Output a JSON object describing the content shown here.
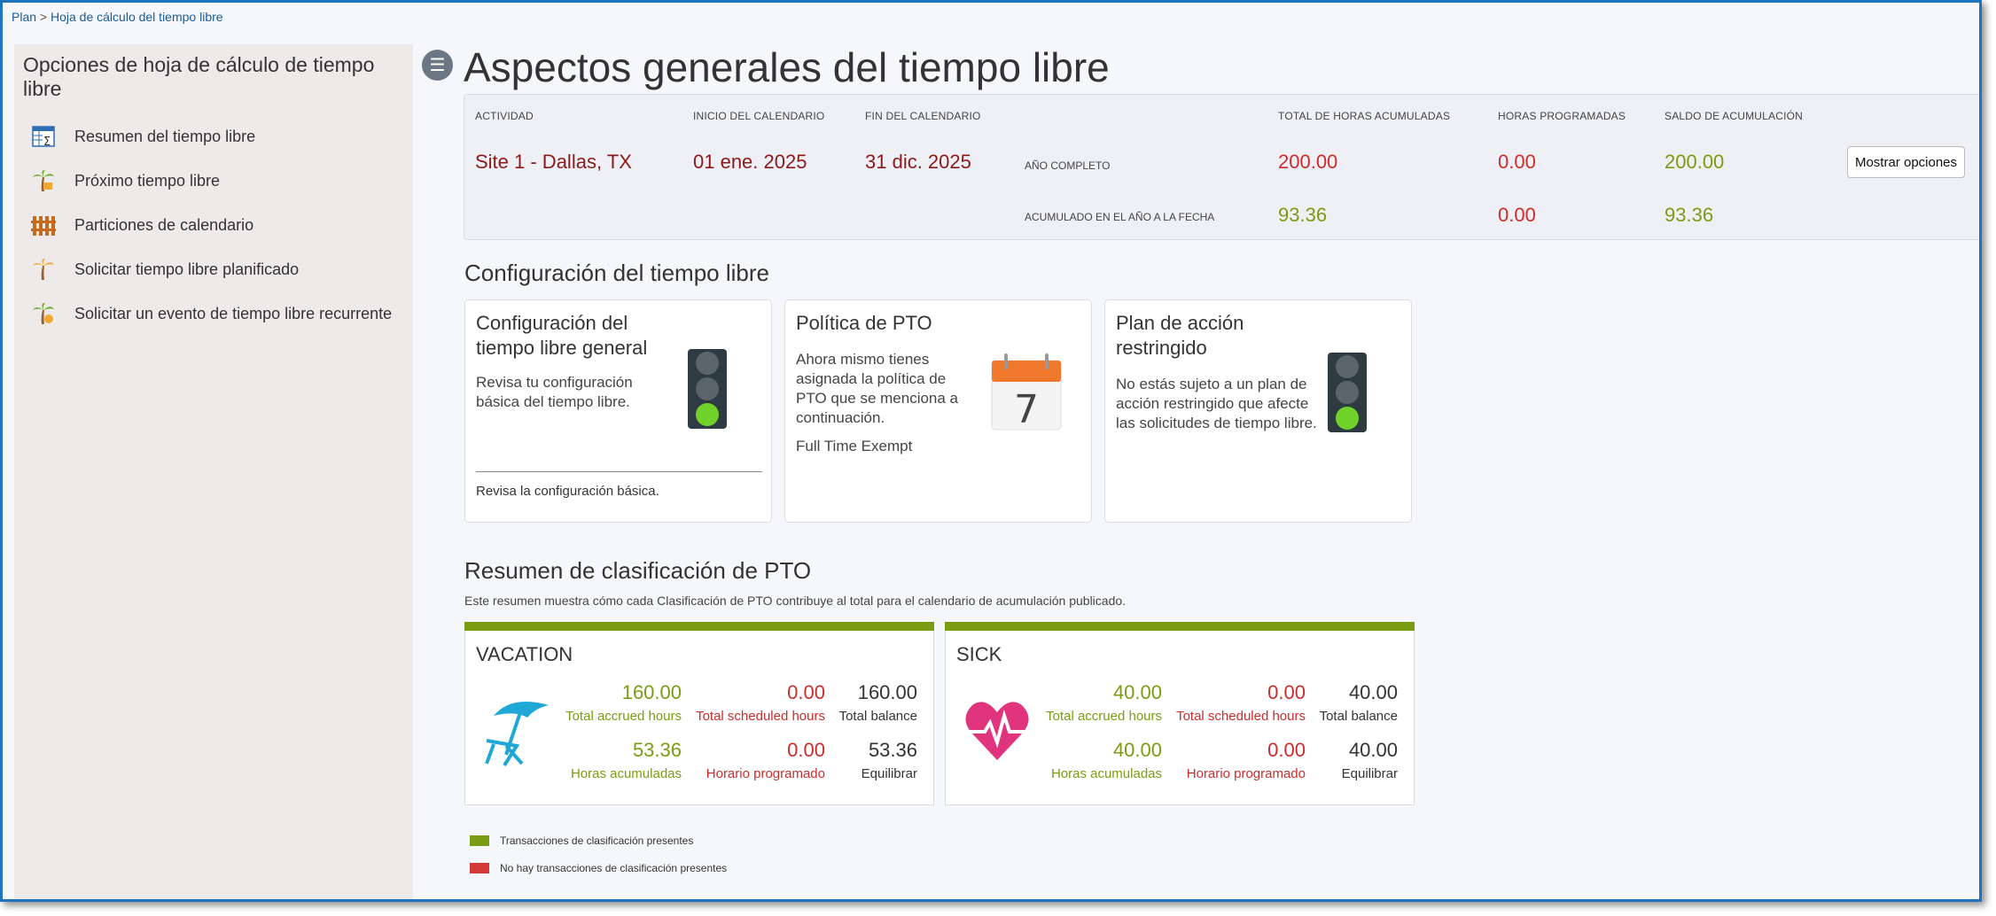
{
  "breadcrumb": {
    "root": "Plan",
    "separator": ">",
    "current": "Hoja de cálculo del tiempo libre"
  },
  "sidebar": {
    "title": "Opciones de hoja de cálculo de tiempo libre",
    "items": [
      {
        "label": "Resumen del tiempo libre",
        "icon": "spreadsheet-sum-icon"
      },
      {
        "label": "Próximo tiempo libre",
        "icon": "palm-tree-icon"
      },
      {
        "label": "Particiones de calendario",
        "icon": "fence-icon"
      },
      {
        "label": "Solicitar tiempo libre planificado",
        "icon": "palm-tree-icon"
      },
      {
        "label": "Solicitar un evento de tiempo libre recurrente",
        "icon": "palm-tree-icon"
      }
    ]
  },
  "page_title": "Aspectos generales del tiempo libre",
  "summary": {
    "headers": {
      "activity": "ACTIVIDAD",
      "calendar_start": "INICIO DEL CALENDARIO",
      "calendar_end": "FIN DEL CALENDARIO",
      "total_accrued": "TOTAL DE HORAS ACUMULADAS",
      "scheduled": "HORAS PROGRAMADAS",
      "balance": "SALDO DE ACUMULACIÓN"
    },
    "activity": "Site 1 - Dallas, TX",
    "calendar_start": "01 ene. 2025",
    "calendar_end": "31 dic. 2025",
    "rows": [
      {
        "label": "AÑO COMPLETO",
        "total_accrued": "200.00",
        "scheduled": "0.00",
        "balance": "200.00"
      },
      {
        "label": "ACUMULADO EN EL AÑO A LA FECHA",
        "total_accrued": "93.36",
        "scheduled": "0.00",
        "balance": "93.36"
      }
    ],
    "options_button": "Mostrar opciones"
  },
  "config": {
    "title": "Configuración del tiempo libre",
    "cards": [
      {
        "title": "Configuración del tiempo libre general",
        "text": "Revisa tu configuración básica del tiempo libre.",
        "footer": "Revisa la configuración básica.",
        "icon": "traffic-light-icon"
      },
      {
        "title": "Política de PTO",
        "text": "Ahora mismo tienes asignada la política de PTO que se menciona a continuación.",
        "policy": "Full Time Exempt",
        "icon": "calendar-icon",
        "calendar_day": "7"
      },
      {
        "title": "Plan de acción restringido",
        "text": "No estás sujeto a un plan de acción restringido que afecte las solicitudes de tiempo libre.",
        "icon": "traffic-light-icon"
      }
    ]
  },
  "pto_summary": {
    "title": "Resumen de clasificación de PTO",
    "subtitle": "Este resumen muestra cómo cada Clasificación de PTO contribuye al total para el calendario de acumulación publicado.",
    "cards": [
      {
        "name": "VACATION",
        "icon": "beach-umbrella-icon",
        "row1": {
          "accrued": "160.00",
          "accrued_label": "Total accrued hours",
          "scheduled": "0.00",
          "scheduled_label": "Total scheduled hours",
          "balance": "160.00",
          "balance_label": "Total balance"
        },
        "row2": {
          "accrued": "53.36",
          "accrued_label": "Horas acumuladas",
          "scheduled": "0.00",
          "scheduled_label": "Horario programado",
          "balance": "53.36",
          "balance_label": "Equilibrar"
        }
      },
      {
        "name": "SICK",
        "icon": "heart-pulse-icon",
        "row1": {
          "accrued": "40.00",
          "accrued_label": "Total accrued hours",
          "scheduled": "0.00",
          "scheduled_label": "Total scheduled hours",
          "balance": "40.00",
          "balance_label": "Total balance"
        },
        "row2": {
          "accrued": "40.00",
          "accrued_label": "Horas acumuladas",
          "scheduled": "0.00",
          "scheduled_label": "Horario programado",
          "balance": "40.00",
          "balance_label": "Equilibrar"
        }
      }
    ],
    "legend": [
      {
        "label": "Transacciones de clasificación presentes",
        "color": "#7a9c12"
      },
      {
        "label": "No hay transacciones de clasificación presentes",
        "color": "#d43a3a"
      }
    ]
  },
  "colors": {
    "accent_green": "#7a9c12",
    "accent_red": "#cc2c2c",
    "dark_red": "#8b1a1a",
    "frame_blue": "#1e73be"
  }
}
